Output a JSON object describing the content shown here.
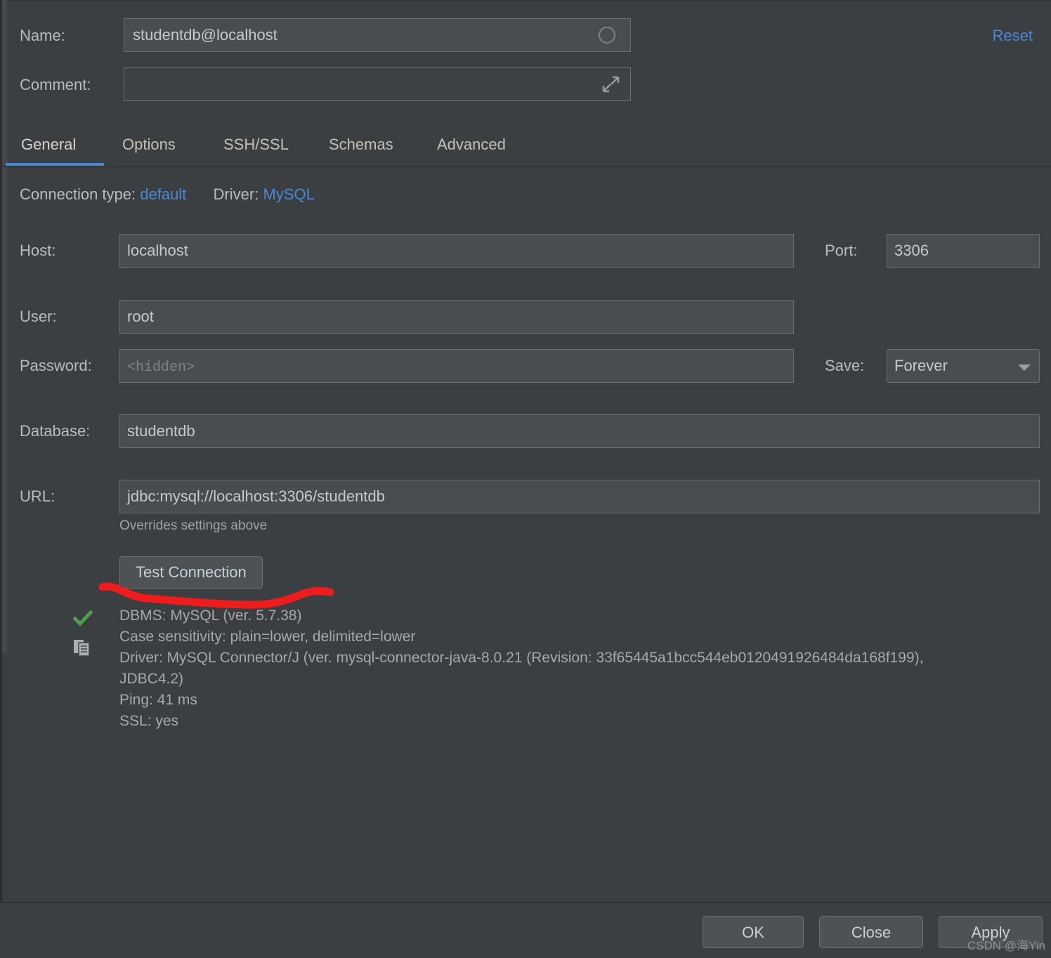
{
  "header": {
    "name_label": "Name:",
    "name_value": "studentdb@localhost",
    "comment_label": "Comment:",
    "comment_value": "",
    "reset_label": "Reset"
  },
  "tabs": [
    {
      "label": "General",
      "active": true
    },
    {
      "label": "Options",
      "active": false
    },
    {
      "label": "SSH/SSL",
      "active": false
    },
    {
      "label": "Schemas",
      "active": false
    },
    {
      "label": "Advanced",
      "active": false
    }
  ],
  "connection": {
    "type_label": "Connection type:",
    "type_value": "default",
    "driver_label": "Driver:",
    "driver_value": "MySQL"
  },
  "fields": {
    "host_label": "Host:",
    "host_value": "localhost",
    "port_label": "Port:",
    "port_value": "3306",
    "user_label": "User:",
    "user_value": "root",
    "password_label": "Password:",
    "password_placeholder": "<hidden>",
    "save_label": "Save:",
    "save_value": "Forever",
    "database_label": "Database:",
    "database_value": "studentdb",
    "url_label": "URL:",
    "url_value": "jdbc:mysql://localhost:3306/studentdb",
    "url_hint": "Overrides settings above"
  },
  "test": {
    "button_label": "Test Connection",
    "result_lines": [
      "DBMS: MySQL (ver. 5.7.38)",
      "Case sensitivity: plain=lower, delimited=lower",
      "Driver: MySQL Connector/J (ver. mysql-connector-java-8.0.21 (Revision: 33f65445a1bcc544eb0120491926484da168f199),",
      "JDBC4.2)",
      "Ping: 41 ms",
      "SSL: yes"
    ]
  },
  "footer": {
    "ok_label": "OK",
    "close_label": "Close",
    "apply_label": "Apply"
  },
  "watermark": "CSDN @海Yin",
  "colors": {
    "background": "#3c3f41",
    "field_background": "#4a4d4f",
    "accent_link": "#4a88d4",
    "tab_underline": "#4a88d4",
    "success_check": "#4f9e4f",
    "annotation": "#ee1c1c",
    "text": "#bbbbbb"
  }
}
